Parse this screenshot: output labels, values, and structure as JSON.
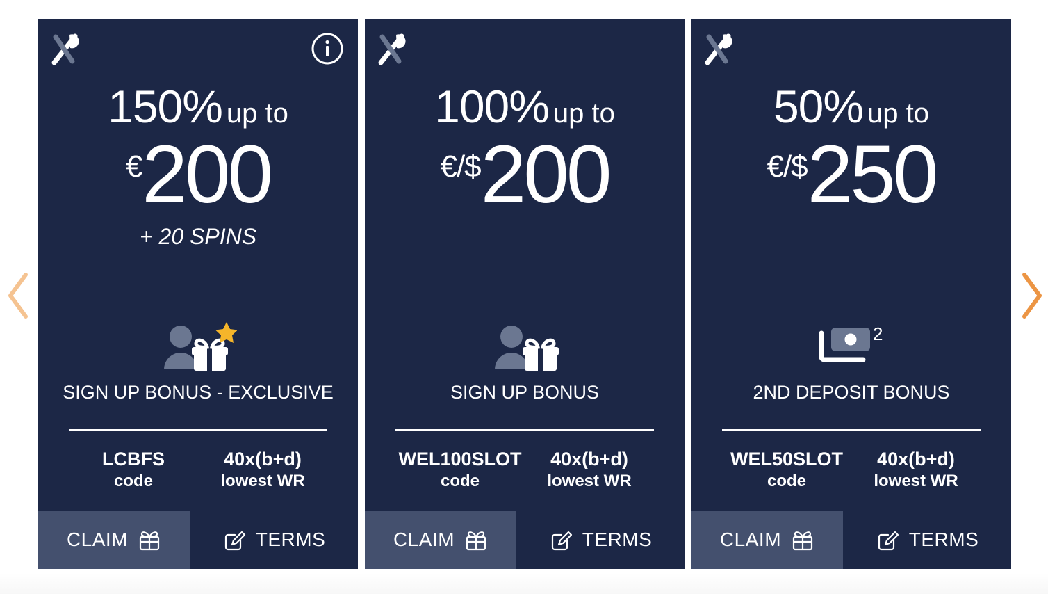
{
  "carousel": {
    "prev_label": "Previous offers",
    "next_label": "Next offers",
    "prev_color": "#f5c391",
    "next_color": "#ec9544"
  },
  "colors": {
    "card_bg": "#1c2746",
    "claim_bg": "#44506e",
    "icon_grey": "#6b7791",
    "star_gold": "#f5b52a",
    "text": "#ffffff"
  },
  "cards": [
    {
      "brand_icon": "crossed-pin-logo",
      "has_info": true,
      "info_icon": "info-circle-icon",
      "percent": "150%",
      "upto": "up to",
      "currency": "€",
      "amount": "200",
      "extra": "+ 20 SPINS",
      "type_icon": "user-gift-star-icon",
      "type_label": "SIGN UP BONUS - EXCLUSIVE",
      "code_value": "LCBFS",
      "code_sub": "code",
      "wr_value": "40x(b+d)",
      "wr_sub": "lowest WR",
      "claim_label": "CLAIM",
      "claim_icon": "gift-icon",
      "terms_label": "TERMS",
      "terms_icon": "edit-square-icon"
    },
    {
      "brand_icon": "crossed-pin-logo",
      "has_info": false,
      "percent": "100%",
      "upto": "up to",
      "currency": "€/$",
      "amount": "200",
      "extra": "",
      "type_icon": "user-gift-icon",
      "type_label": "SIGN UP BONUS",
      "code_value": "WEL100SLOT",
      "code_sub": "code",
      "wr_value": "40x(b+d)",
      "wr_sub": "lowest WR",
      "claim_label": "CLAIM",
      "claim_icon": "gift-icon",
      "terms_label": "TERMS",
      "terms_icon": "edit-square-icon"
    },
    {
      "brand_icon": "crossed-pin-logo",
      "has_info": false,
      "percent": "50%",
      "upto": "up to",
      "currency": "€/$",
      "amount": "250",
      "extra": "",
      "type_icon": "banknotes-two-icon",
      "type_badge": "2",
      "type_label": "2ND DEPOSIT BONUS",
      "code_value": "WEL50SLOT",
      "code_sub": "code",
      "wr_value": "40x(b+d)",
      "wr_sub": "lowest WR",
      "claim_label": "CLAIM",
      "claim_icon": "gift-icon",
      "terms_label": "TERMS",
      "terms_icon": "edit-square-icon"
    }
  ]
}
